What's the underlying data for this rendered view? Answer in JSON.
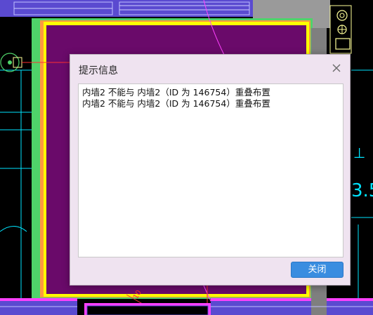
{
  "dialog": {
    "title": "提示信息",
    "close_icon": "close-icon",
    "messages": [
      "内墙2 不能与 内墙2（ID 为 146754）重叠布置",
      "内墙2 不能与 内墙2（ID 为 146754）重叠布置"
    ],
    "close_button_label": "关闭",
    "button_color": "#3a8de0"
  },
  "cad_background": {
    "room_fill_color": "#6a0a6a",
    "wall_color_green": "#4fd36a",
    "wall_color_yellow": "#ffff00",
    "wall_color_orange": "#ff9a40",
    "line_color_cyan": "#00e5ff",
    "ceiling_band_color": "#5a4ad0",
    "right_text": "3.5"
  }
}
